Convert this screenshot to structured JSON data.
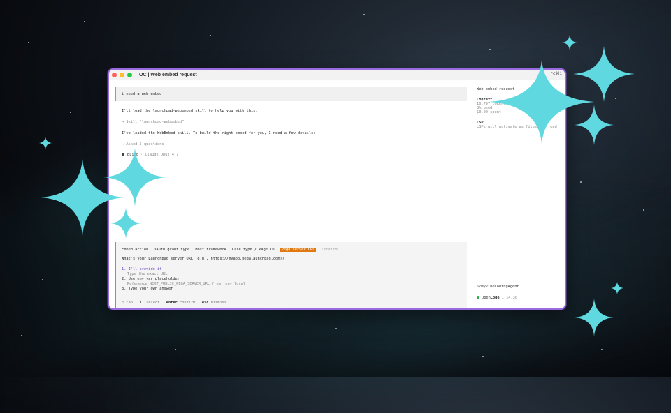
{
  "window": {
    "title": "OC | Web embed request",
    "shortcut": "⌥⌘1"
  },
  "conversation": {
    "user_message": "i need a web embed",
    "assistant_line_1": "I'll load the launchpad-webembed skill to help you with this.",
    "skill_line": "→ Skill \"launchpad-webembed\"",
    "assistant_line_2": "I've loaded the WebEmbed skill. To build the right embed for you, I need a few details:",
    "asked_line": "→ Asked 5 questions",
    "build_label": "Build",
    "build_model": "· Claude Opus 4.7"
  },
  "question_panel": {
    "tabs": [
      {
        "label": "Embed action",
        "state": "normal"
      },
      {
        "label": "OAuth grant type",
        "state": "normal"
      },
      {
        "label": "Host framework",
        "state": "normal"
      },
      {
        "label": "Case type / Page ID",
        "state": "normal"
      },
      {
        "label": "Pega server URL",
        "state": "active"
      },
      {
        "label": "Confirm",
        "state": "faded"
      }
    ],
    "question": "What's your Launchpad server URL (e.g., https://myapp.pegalaunchpad.com)?",
    "options": [
      {
        "label": "1. I'll provide it",
        "desc": "Type the exact URL"
      },
      {
        "label": "2. Use env var placeholder",
        "desc": "Reference NEXT_PUBLIC_PEGA_SERVER_URL from .env.local"
      },
      {
        "label": "3. Type your own answer",
        "desc": ""
      }
    ],
    "hints": {
      "tab_key": "⇆ tab",
      "select_key": "↑↓",
      "select_label": "select",
      "enter_key": "enter",
      "enter_label": "confirm",
      "esc_key": "esc",
      "esc_label": "dismiss"
    }
  },
  "sidebar": {
    "title": "Web embed request",
    "context_title": "Context",
    "tokens": "16,797 tokens",
    "used": "8% used",
    "spent": "$0.00 spent",
    "lsp_title": "LSP",
    "lsp_text": "LSPs will activate as files are read",
    "path": "~/MyVibeCodingAgent",
    "app_name_a": "Open",
    "app_name_b": "Code",
    "version": "1.14.30"
  },
  "colors": {
    "window_border": "#9a6ae0",
    "active_tab": "#e07a10",
    "sparkle": "#5fd8e0",
    "status_green": "#2bb24c"
  }
}
